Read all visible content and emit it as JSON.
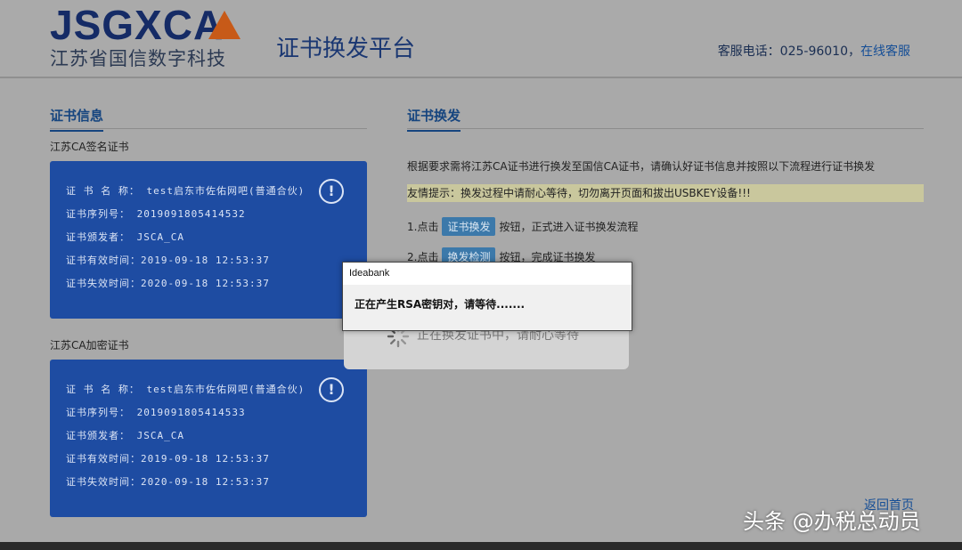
{
  "header": {
    "logo_text": "JSGXCA",
    "company": "江苏省国信数字科技",
    "title": "证书换发平台",
    "service_label": "客服电话：025-96010，",
    "online_service": "在线客服"
  },
  "left": {
    "section_title": "证书信息",
    "certs": [
      {
        "label": "江苏CA签名证书",
        "name_label": "证 书  名 称：",
        "name": "test启东市佐佑网吧(普通合伙)",
        "serial_label": "证书序列号：",
        "serial": "2019091805414532",
        "issuer_label": "证书颁发者：",
        "issuer": "JSCA_CA",
        "valid_from_label": "证书有效时间：",
        "valid_from": "2019-09-18 12:53:37",
        "valid_to_label": "证书失效时间：",
        "valid_to": "2020-09-18 12:53:37",
        "warn_icon": "!"
      },
      {
        "label": "江苏CA加密证书",
        "name_label": "证 书  名 称：",
        "name": "test启东市佐佑网吧(普通合伙)",
        "serial_label": "证书序列号：",
        "serial": "2019091805414533",
        "issuer_label": "证书颁发者：",
        "issuer": "JSCA_CA",
        "valid_from_label": "证书有效时间：",
        "valid_from": "2019-09-18 12:53:37",
        "valid_to_label": "证书失效时间：",
        "valid_to": "2020-09-18 12:53:37",
        "warn_icon": "!"
      }
    ]
  },
  "right": {
    "section_title": "证书换发",
    "description": "根据要求需将江苏CA证书进行换发至国信CA证书，请确认好证书信息并按照以下流程进行证书换发",
    "tip": "友情提示：换发过程中请耐心等待，切勿离开页面和拔出USBKEY设备!!!",
    "step1_prefix": "1.点击",
    "step1_button": "证书换发",
    "step1_suffix": "按钮，正式进入证书换发流程",
    "step2_prefix": "2.点击",
    "step2_button": "换发检测",
    "step2_suffix": "按钮，完成证书换发",
    "back_link": "返回首页"
  },
  "loading": {
    "text": "正在换发证书中，请耐心等待"
  },
  "dialog": {
    "title": "Ideabank",
    "message": "正在产生RSA密钥对，请等待......."
  },
  "watermark": "头条 @办税总动员",
  "colors": {
    "card_bg": "#1e4ca2",
    "title_blue": "#16457f",
    "tip_bg": "#c9c79d",
    "logo_accent": "#c75a18"
  }
}
